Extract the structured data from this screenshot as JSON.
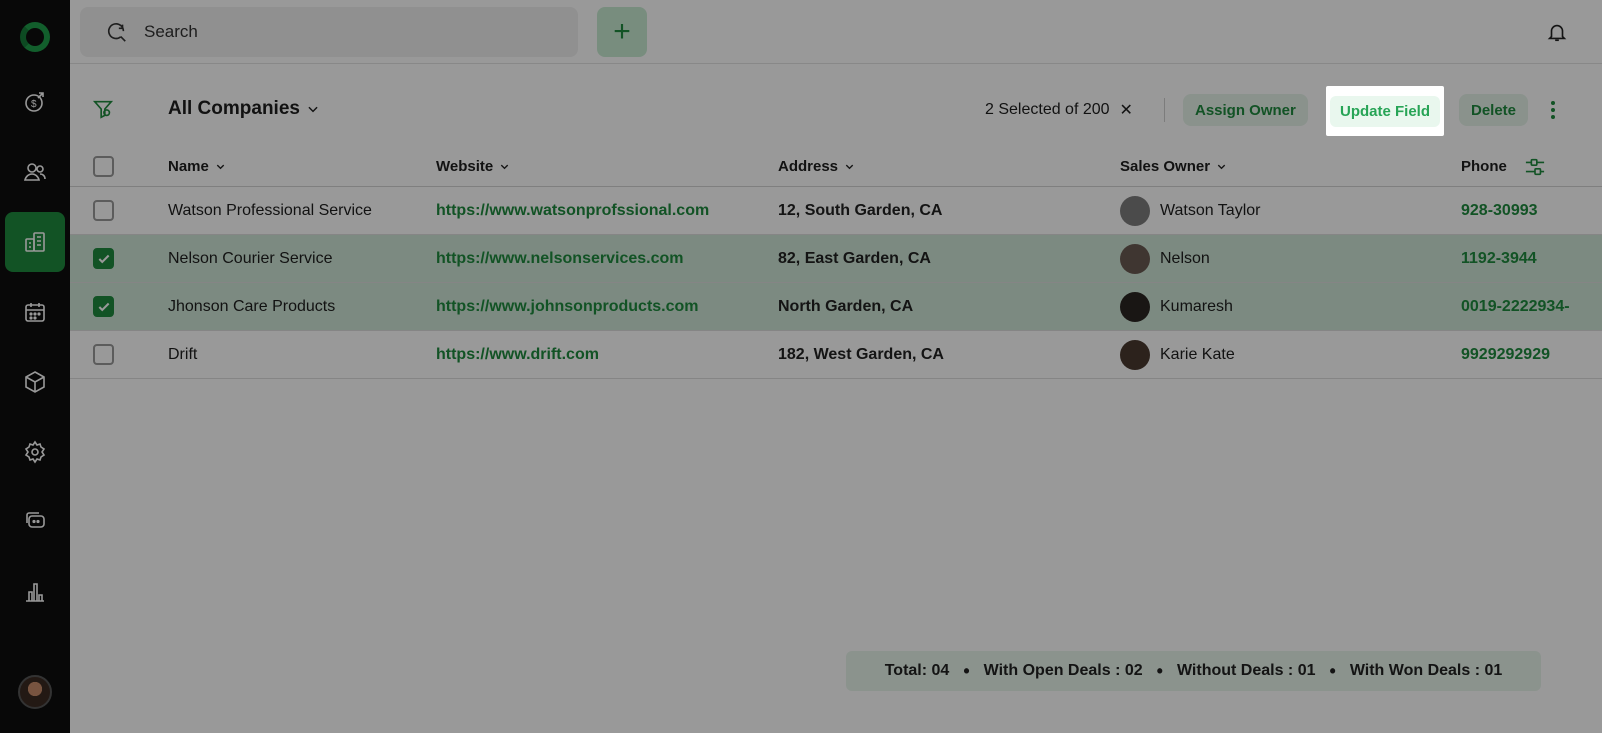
{
  "search": {
    "label": "Search"
  },
  "add_label": "+",
  "view": {
    "title": "All Companies"
  },
  "selection": {
    "text": "2 Selected of 200",
    "clear_label": "✕"
  },
  "actions": {
    "assign": "Assign Owner",
    "update": "Update Field",
    "delete": "Delete"
  },
  "columns": {
    "name": "Name",
    "website": "Website",
    "address": "Address",
    "owner": "Sales Owner",
    "phone": "Phone"
  },
  "rows": [
    {
      "name": "Watson Professional Service",
      "website": "https://www.watsonprofssional.com",
      "address": "12, South Garden, CA",
      "owner": "Watson Taylor",
      "phone": "928-30993",
      "checked": false
    },
    {
      "name": "Nelson Courier Service",
      "website": "https://www.nelsonservices.com",
      "address": "82, East Garden, CA",
      "owner": "Nelson",
      "phone": "1192-3944",
      "checked": true
    },
    {
      "name": "Jhonson Care Products",
      "website": "https://www.johnsonproducts.com",
      "address": "North Garden, CA",
      "owner": "Kumaresh",
      "phone": "0019-2222934-",
      "checked": true
    },
    {
      "name": "Drift",
      "website": "https://www.drift.com",
      "address": "182, West Garden, CA",
      "owner": "Karie Kate",
      "phone": "9929292929",
      "checked": false
    }
  ],
  "summary": {
    "total": "Total: 04",
    "open": "With Open Deals : 02",
    "without": "Without Deals : 01",
    "won": "With Won Deals : 01",
    "sep": "•"
  },
  "colors": {
    "accent": "#1f8a3e",
    "sidebar": "#0e0e0e",
    "selected_row": "#cfe7d7"
  },
  "icons": [
    "deals-icon",
    "contacts-icon",
    "companies-icon",
    "calendar-icon",
    "products-icon",
    "settings-icon",
    "chat-icon",
    "reports-icon"
  ]
}
